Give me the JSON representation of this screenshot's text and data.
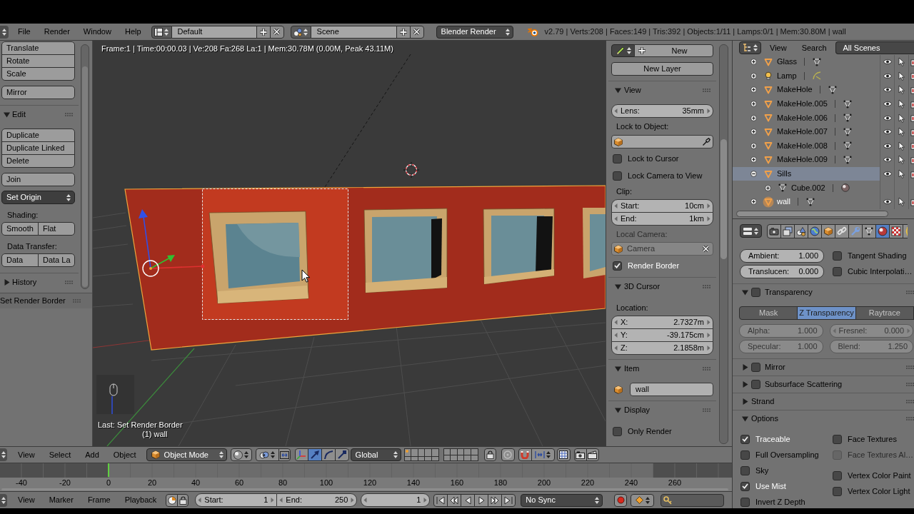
{
  "info_header": {
    "menus": [
      "File",
      "Render",
      "Window",
      "Help"
    ],
    "screen_layout": "Default",
    "scene": "Scene",
    "render_engine": "Blender Render",
    "stats": "v2.79 | Verts:208 | Faces:149 | Tris:392 | Objects:1/11 | Lamps:0/1 | Mem:30.80M | wall"
  },
  "tool_shelf": {
    "items": [
      {
        "kind": "column",
        "buttons": [
          "Translate",
          "Rotate",
          "Scale"
        ]
      },
      {
        "kind": "column",
        "buttons": [
          "Mirror"
        ]
      },
      {
        "kind": "panel",
        "label": "Edit",
        "expanded": true
      },
      {
        "kind": "column",
        "buttons": [
          "Duplicate",
          "Duplicate Linked",
          "Delete"
        ]
      },
      {
        "kind": "column",
        "buttons": [
          "Join"
        ]
      },
      {
        "kind": "menu",
        "label": "Set Origin"
      },
      {
        "kind": "label",
        "label": "Shading:"
      },
      {
        "kind": "row",
        "buttons": [
          "Smooth",
          "Flat"
        ]
      },
      {
        "kind": "label",
        "label": "Data Transfer:"
      },
      {
        "kind": "row",
        "buttons": [
          "Data",
          "Data La"
        ]
      },
      {
        "kind": "panel",
        "label": "History",
        "expanded": false
      }
    ],
    "operator_panel": "Set Render Border"
  },
  "viewport": {
    "stats": "Frame:1 | Time:00:00.03 | Ve:208 Fa:268 La:1 | Mem:30.78M (0.00M, Peak 43.11M)",
    "last_operator": "Last: Set Render Border",
    "active_object": "(1) wall"
  },
  "sidebar": {
    "grease_pencil": {
      "new": "New",
      "new_layer": "New Layer"
    },
    "panels": [
      {
        "label": "View",
        "expanded": true,
        "rows": [
          {
            "kind": "number",
            "fields": [
              {
                "label": "Lens:",
                "value": "35mm"
              }
            ]
          },
          {
            "kind": "label",
            "text": "Lock to Object:",
            "disabled": false
          },
          {
            "kind": "object_picker"
          },
          {
            "kind": "checkbox",
            "label": "Lock to Cursor",
            "checked": false
          },
          {
            "kind": "checkbox",
            "label": "Lock Camera to View",
            "checked": false
          },
          {
            "kind": "label",
            "text": "Clip:",
            "disabled": false
          },
          {
            "kind": "number",
            "fields": [
              {
                "label": "Start:",
                "value": "10cm"
              },
              {
                "label": "End:",
                "value": "1km"
              }
            ]
          },
          {
            "kind": "label",
            "text": "Local Camera:",
            "disabled": true
          },
          {
            "kind": "object_field",
            "value": "Camera",
            "disabled": true
          },
          {
            "kind": "checkbox",
            "label": "Render Border",
            "checked": true
          }
        ]
      },
      {
        "label": "3D Cursor",
        "expanded": true,
        "rows": [
          {
            "kind": "label",
            "text": "Location:",
            "disabled": false
          },
          {
            "kind": "number",
            "fields": [
              {
                "label": "X:",
                "value": "2.7327m"
              },
              {
                "label": "Y:",
                "value": "-39.175cm"
              },
              {
                "label": "Z:",
                "value": "2.1858m"
              }
            ]
          }
        ]
      },
      {
        "label": "Item",
        "expanded": true,
        "rows": [
          {
            "kind": "name_field",
            "value": "wall"
          }
        ]
      },
      {
        "label": "Display",
        "expanded": true,
        "rows": [
          {
            "kind": "checkbox",
            "label": "Only Render",
            "checked": false
          }
        ]
      }
    ]
  },
  "view_header": {
    "menus": [
      "View",
      "Select",
      "Add",
      "Object"
    ],
    "mode": "Object Mode",
    "manipulators": [
      {
        "kind": "translate",
        "selected": true
      },
      {
        "kind": "rotate",
        "selected": false
      },
      {
        "kind": "scale",
        "selected": false
      }
    ],
    "orientation": "Global",
    "layers": [
      {
        "has_active_object": true
      },
      {
        "has_active_object": false
      },
      {
        "has_active_object": false
      },
      {
        "has_active_object": false
      },
      {
        "has_active_object": false
      },
      {
        "has_active_object": false
      },
      {
        "has_active_object": false
      },
      {
        "has_active_object": false
      },
      {
        "has_active_object": false
      },
      {
        "has_active_object": false
      },
      {
        "has_active_object": false
      },
      {
        "has_active_object": false
      },
      {
        "has_active_object": false
      },
      {
        "has_active_object": false
      },
      {
        "has_active_object": false
      },
      {
        "has_active_object": false
      },
      {
        "has_active_object": false
      },
      {
        "has_active_object": false
      },
      {
        "has_active_object": false
      },
      {
        "has_active_object": false
      }
    ]
  },
  "timeline": {
    "frame_labels": [
      "-40",
      "-20",
      "0",
      "20",
      "40",
      "60",
      "80",
      "100",
      "120",
      "140",
      "160",
      "180",
      "200",
      "220",
      "240",
      "260"
    ]
  },
  "timeline_header": {
    "menus": [
      "View",
      "Marker",
      "Frame",
      "Playback"
    ],
    "range": [
      {
        "label": "Start:",
        "value": "1"
      },
      {
        "label": "End:",
        "value": "250"
      }
    ],
    "current_frame": "1",
    "sync": "No Sync"
  },
  "outliner": {
    "menus": [
      "View",
      "Search"
    ],
    "filter": "All Scenes",
    "items": [
      {
        "name": "Glass",
        "kind": "mesh",
        "expanded": false,
        "selected": false,
        "active": false
      },
      {
        "name": "Lamp",
        "kind": "lamp",
        "expanded": false,
        "selected": false,
        "active": false
      },
      {
        "name": "MakeHole",
        "kind": "mesh",
        "expanded": false,
        "selected": false,
        "active": false
      },
      {
        "name": "MakeHole.005",
        "kind": "mesh",
        "expanded": false,
        "selected": false,
        "active": false
      },
      {
        "name": "MakeHole.006",
        "kind": "mesh",
        "expanded": false,
        "selected": false,
        "active": false
      },
      {
        "name": "MakeHole.007",
        "kind": "mesh",
        "expanded": false,
        "selected": false,
        "active": false
      },
      {
        "name": "MakeHole.008",
        "kind": "mesh",
        "expanded": false,
        "selected": false,
        "active": false
      },
      {
        "name": "MakeHole.009",
        "kind": "mesh",
        "expanded": false,
        "selected": false,
        "active": false
      },
      {
        "name": "Sills",
        "kind": "mesh",
        "expanded": true,
        "selected": true,
        "active": false,
        "children": [
          {
            "name": "Cube.002",
            "kind": "mesh_data",
            "expanded": false,
            "selected": false,
            "active": false
          }
        ]
      },
      {
        "name": "wall",
        "kind": "mesh",
        "expanded": false,
        "selected": false,
        "active": true
      }
    ]
  },
  "properties": {
    "tabs": [
      {
        "kind": "render",
        "selected": false
      },
      {
        "kind": "render_layers",
        "selected": false
      },
      {
        "kind": "scene",
        "selected": false
      },
      {
        "kind": "world",
        "selected": false
      },
      {
        "kind": "object",
        "selected": false
      },
      {
        "kind": "constraints",
        "selected": false
      },
      {
        "kind": "modifiers",
        "selected": false
      },
      {
        "kind": "data",
        "selected": false
      },
      {
        "kind": "material",
        "selected": true
      },
      {
        "kind": "texture",
        "selected": false
      },
      {
        "kind": "particles",
        "selected": false
      }
    ],
    "shading_rows": [
      {
        "field": {
          "label": "Ambient:",
          "value": "1.000"
        },
        "checkbox": {
          "label": "Tangent Shading",
          "checked": false
        }
      },
      {
        "field": {
          "label": "Translucen:",
          "value": "0.000"
        },
        "checkbox": {
          "label": "Cubic Interpolati…",
          "checked": false
        }
      }
    ],
    "panels": [
      {
        "label": "Transparency",
        "expanded": true,
        "enabled": false,
        "modes": [
          {
            "label": "Mask",
            "selected": false
          },
          {
            "label": "Z Transparency",
            "selected": true
          },
          {
            "label": "Raytrace",
            "selected": false
          }
        ],
        "fields": [
          [
            {
              "kind": "slider",
              "label": "Alpha:",
              "value": "1.000",
              "disabled": true
            },
            {
              "kind": "number",
              "label": "Fresnel:",
              "value": "0.000",
              "disabled": true
            }
          ],
          [
            {
              "kind": "slider",
              "label": "Specular:",
              "value": "1.000",
              "disabled": true
            },
            {
              "kind": "slider",
              "label": "Blend:",
              "value": "1.250",
              "disabled": true
            }
          ]
        ]
      },
      {
        "label": "Mirror",
        "expanded": false,
        "enabled": false
      },
      {
        "label": "Subsurface Scattering",
        "expanded": false,
        "enabled": false
      },
      {
        "label": "Strand",
        "expanded": false
      },
      {
        "label": "Options",
        "expanded": true,
        "columns": [
          [
            [
              {
                "label": "Traceable",
                "checked": true,
                "disabled": false
              },
              {
                "label": "Full Oversampling",
                "checked": false,
                "disabled": false
              },
              {
                "label": "Sky",
                "checked": false,
                "disabled": false
              },
              {
                "label": "Use Mist",
                "checked": true,
                "disabled": false
              },
              {
                "label": "Invert Z Depth",
                "checked": false,
                "disabled": false
              }
            ]
          ],
          [
            [
              {
                "label": "Face Textures",
                "checked": false,
                "disabled": false
              },
              {
                "label": "Face Textures Al…",
                "checked": false,
                "disabled": true
              }
            ],
            [
              {
                "label": "Vertex Color Paint",
                "checked": false,
                "disabled": false
              },
              {
                "label": "Vertex Color Light",
                "checked": false,
                "disabled": false
              }
            ]
          ]
        ]
      }
    ]
  }
}
